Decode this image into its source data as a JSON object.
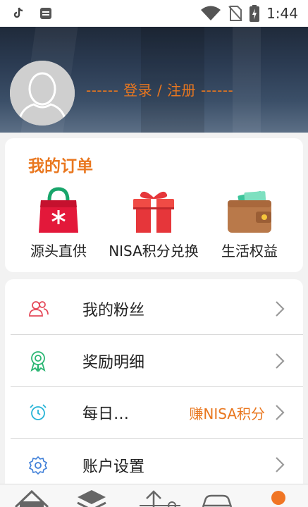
{
  "status_bar": {
    "time": "1:44",
    "icons": [
      "tiktok-icon",
      "app-icon",
      "wifi-icon",
      "no-sim-icon",
      "battery-charging-icon"
    ]
  },
  "header": {
    "login_text": "------ 登录 / 注册 ------",
    "avatar": "default-avatar-icon"
  },
  "orders": {
    "title": "我的订单",
    "items": [
      {
        "label": "源头直供",
        "icon": "shopping-bag-icon"
      },
      {
        "label": "NISA积分兑换",
        "icon": "gift-box-icon"
      },
      {
        "label": "生活权益",
        "icon": "wallet-icon"
      }
    ]
  },
  "menu": {
    "items": [
      {
        "label": "我的粉丝",
        "icon": "fans-icon",
        "extra": ""
      },
      {
        "label": "奖励明细",
        "icon": "award-icon",
        "extra": ""
      },
      {
        "label": "每日…",
        "icon": "alarm-clock-icon",
        "extra": "赚NISA积分"
      },
      {
        "label": "账户设置",
        "icon": "settings-icon",
        "extra": ""
      }
    ]
  },
  "bottom_nav": {
    "icons": [
      "home-icon",
      "layers-icon",
      "share-icon",
      "car-icon",
      "profile-dot-icon"
    ]
  },
  "colors": {
    "accent": "#e9771f",
    "header_bg": "#2b3b52",
    "card_bg": "#ffffff",
    "page_bg": "#f2f2f2"
  }
}
